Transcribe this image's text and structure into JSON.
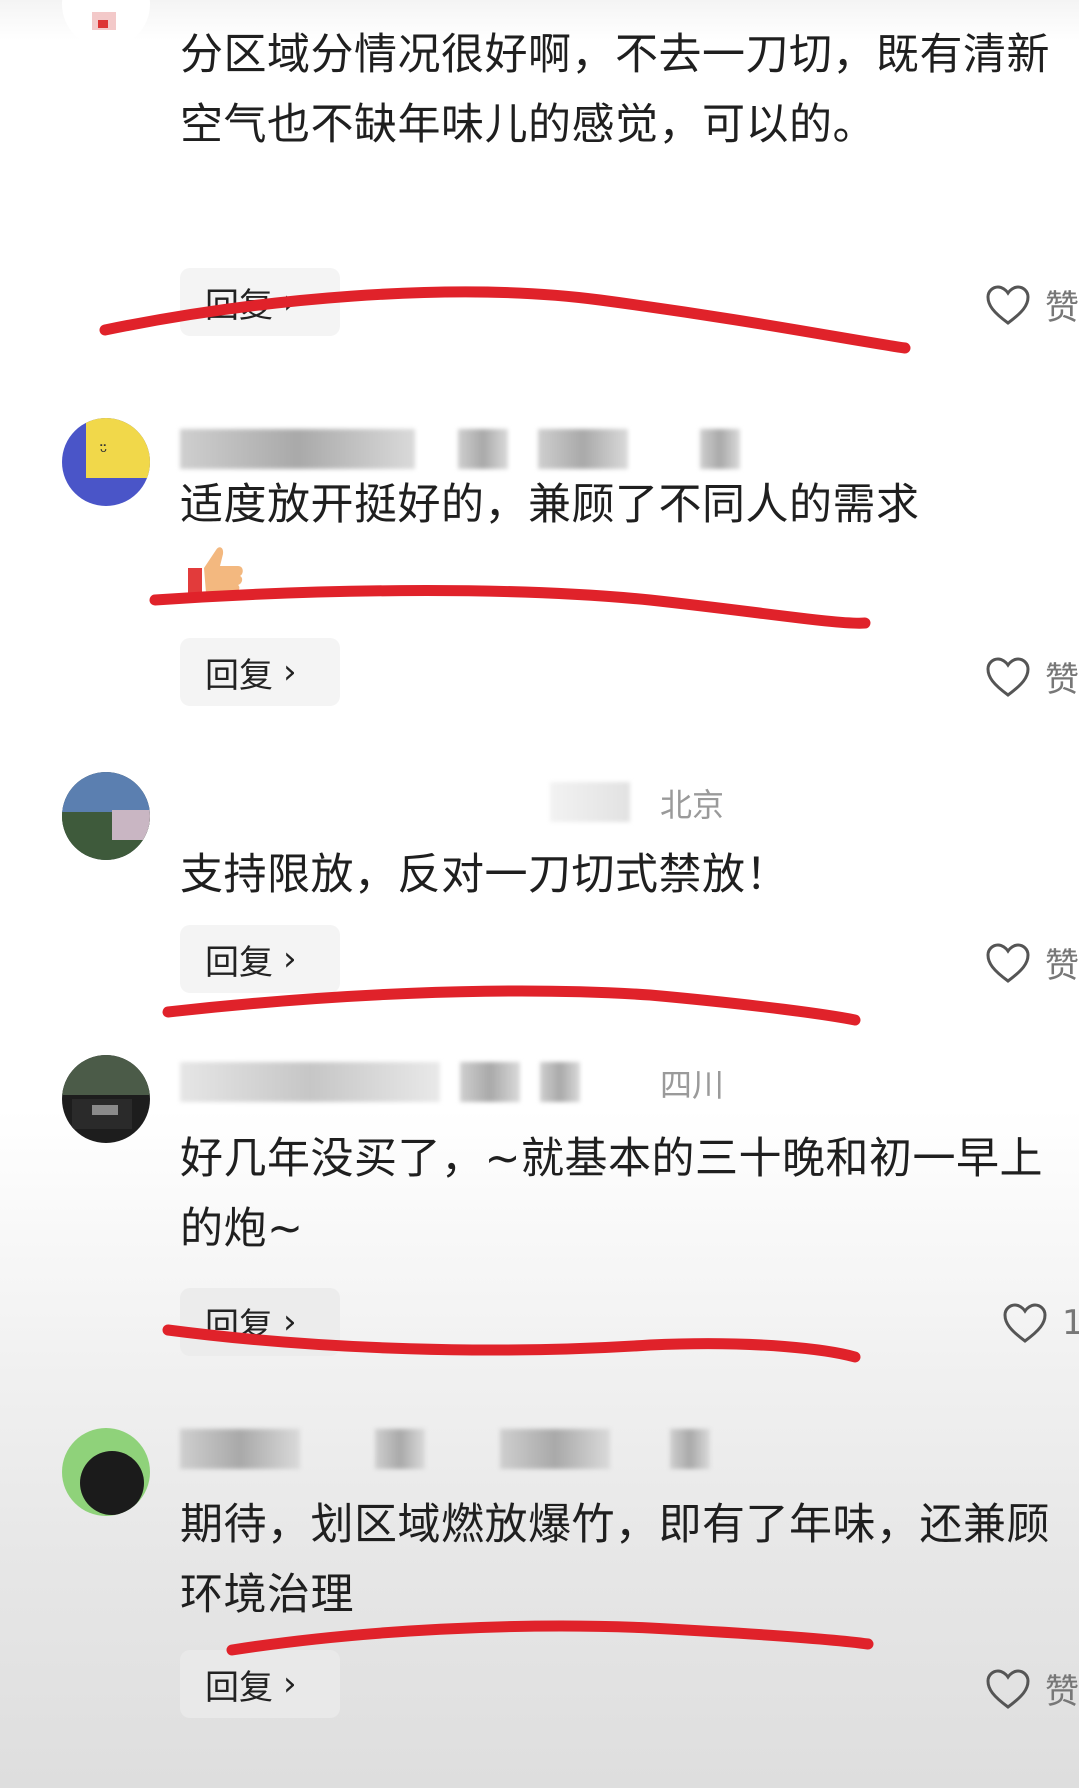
{
  "comments": [
    {
      "text": "分区域分情况很好啊，不去一刀切，既有清新空气也不缺年味儿的感觉，可以的。",
      "location": "",
      "reply_label": "回复",
      "like_label": "赞"
    },
    {
      "text": "适度放开挺好的，兼顾了不同人的需求",
      "emoji": "👍",
      "location": "",
      "reply_label": "回复",
      "like_label": "赞"
    },
    {
      "text": "支持限放，反对一刀切式禁放！",
      "location": "北京",
      "reply_label": "回复",
      "like_label": "赞"
    },
    {
      "text": "好几年没买了，~就基本的三十晚和初一早上的炮~",
      "location": "四川",
      "reply_label": "回复",
      "like_label": "1"
    },
    {
      "text": "期待，划区域燃放爆竹，即有了年味，还兼顾环境治理",
      "location": "",
      "reply_label": "回复",
      "like_label": "赞"
    }
  ],
  "annotation_color": "#e0222a",
  "icons": {
    "like": "heart-outline-icon",
    "reply_chevron": "chevron-right-icon"
  }
}
